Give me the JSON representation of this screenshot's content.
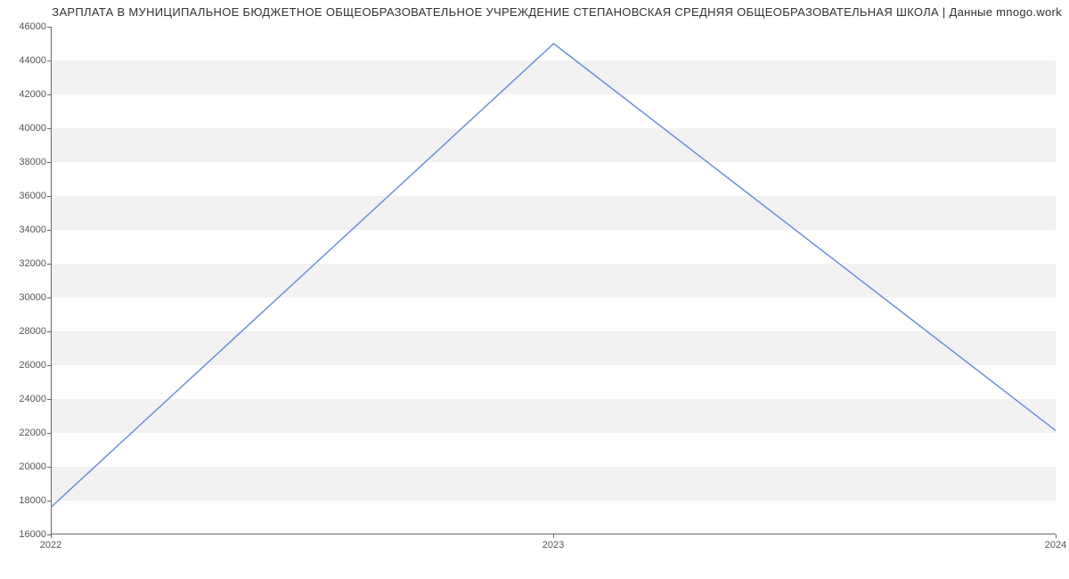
{
  "chart_data": {
    "type": "line",
    "title": "ЗАРПЛАТА В МУНИЦИПАЛЬНОЕ БЮДЖЕТНОЕ ОБЩЕОБРАЗОВАТЕЛЬНОЕ УЧРЕЖДЕНИЕ СТЕПАНОВСКАЯ СРЕДНЯЯ ОБЩЕОБРАЗОВАТЕЛЬНАЯ ШКОЛА | Данные mnogo.work",
    "xlabel": "",
    "ylabel": "",
    "x": [
      "2022",
      "2023",
      "2024"
    ],
    "values": [
      17600,
      45000,
      22100
    ],
    "ylim": [
      16000,
      46000
    ],
    "y_ticks": [
      16000,
      18000,
      20000,
      22000,
      24000,
      26000,
      28000,
      30000,
      32000,
      34000,
      36000,
      38000,
      40000,
      42000,
      44000,
      46000
    ],
    "x_ticks": [
      "2022",
      "2023",
      "2024"
    ],
    "line_color": "#6a8fd8"
  }
}
